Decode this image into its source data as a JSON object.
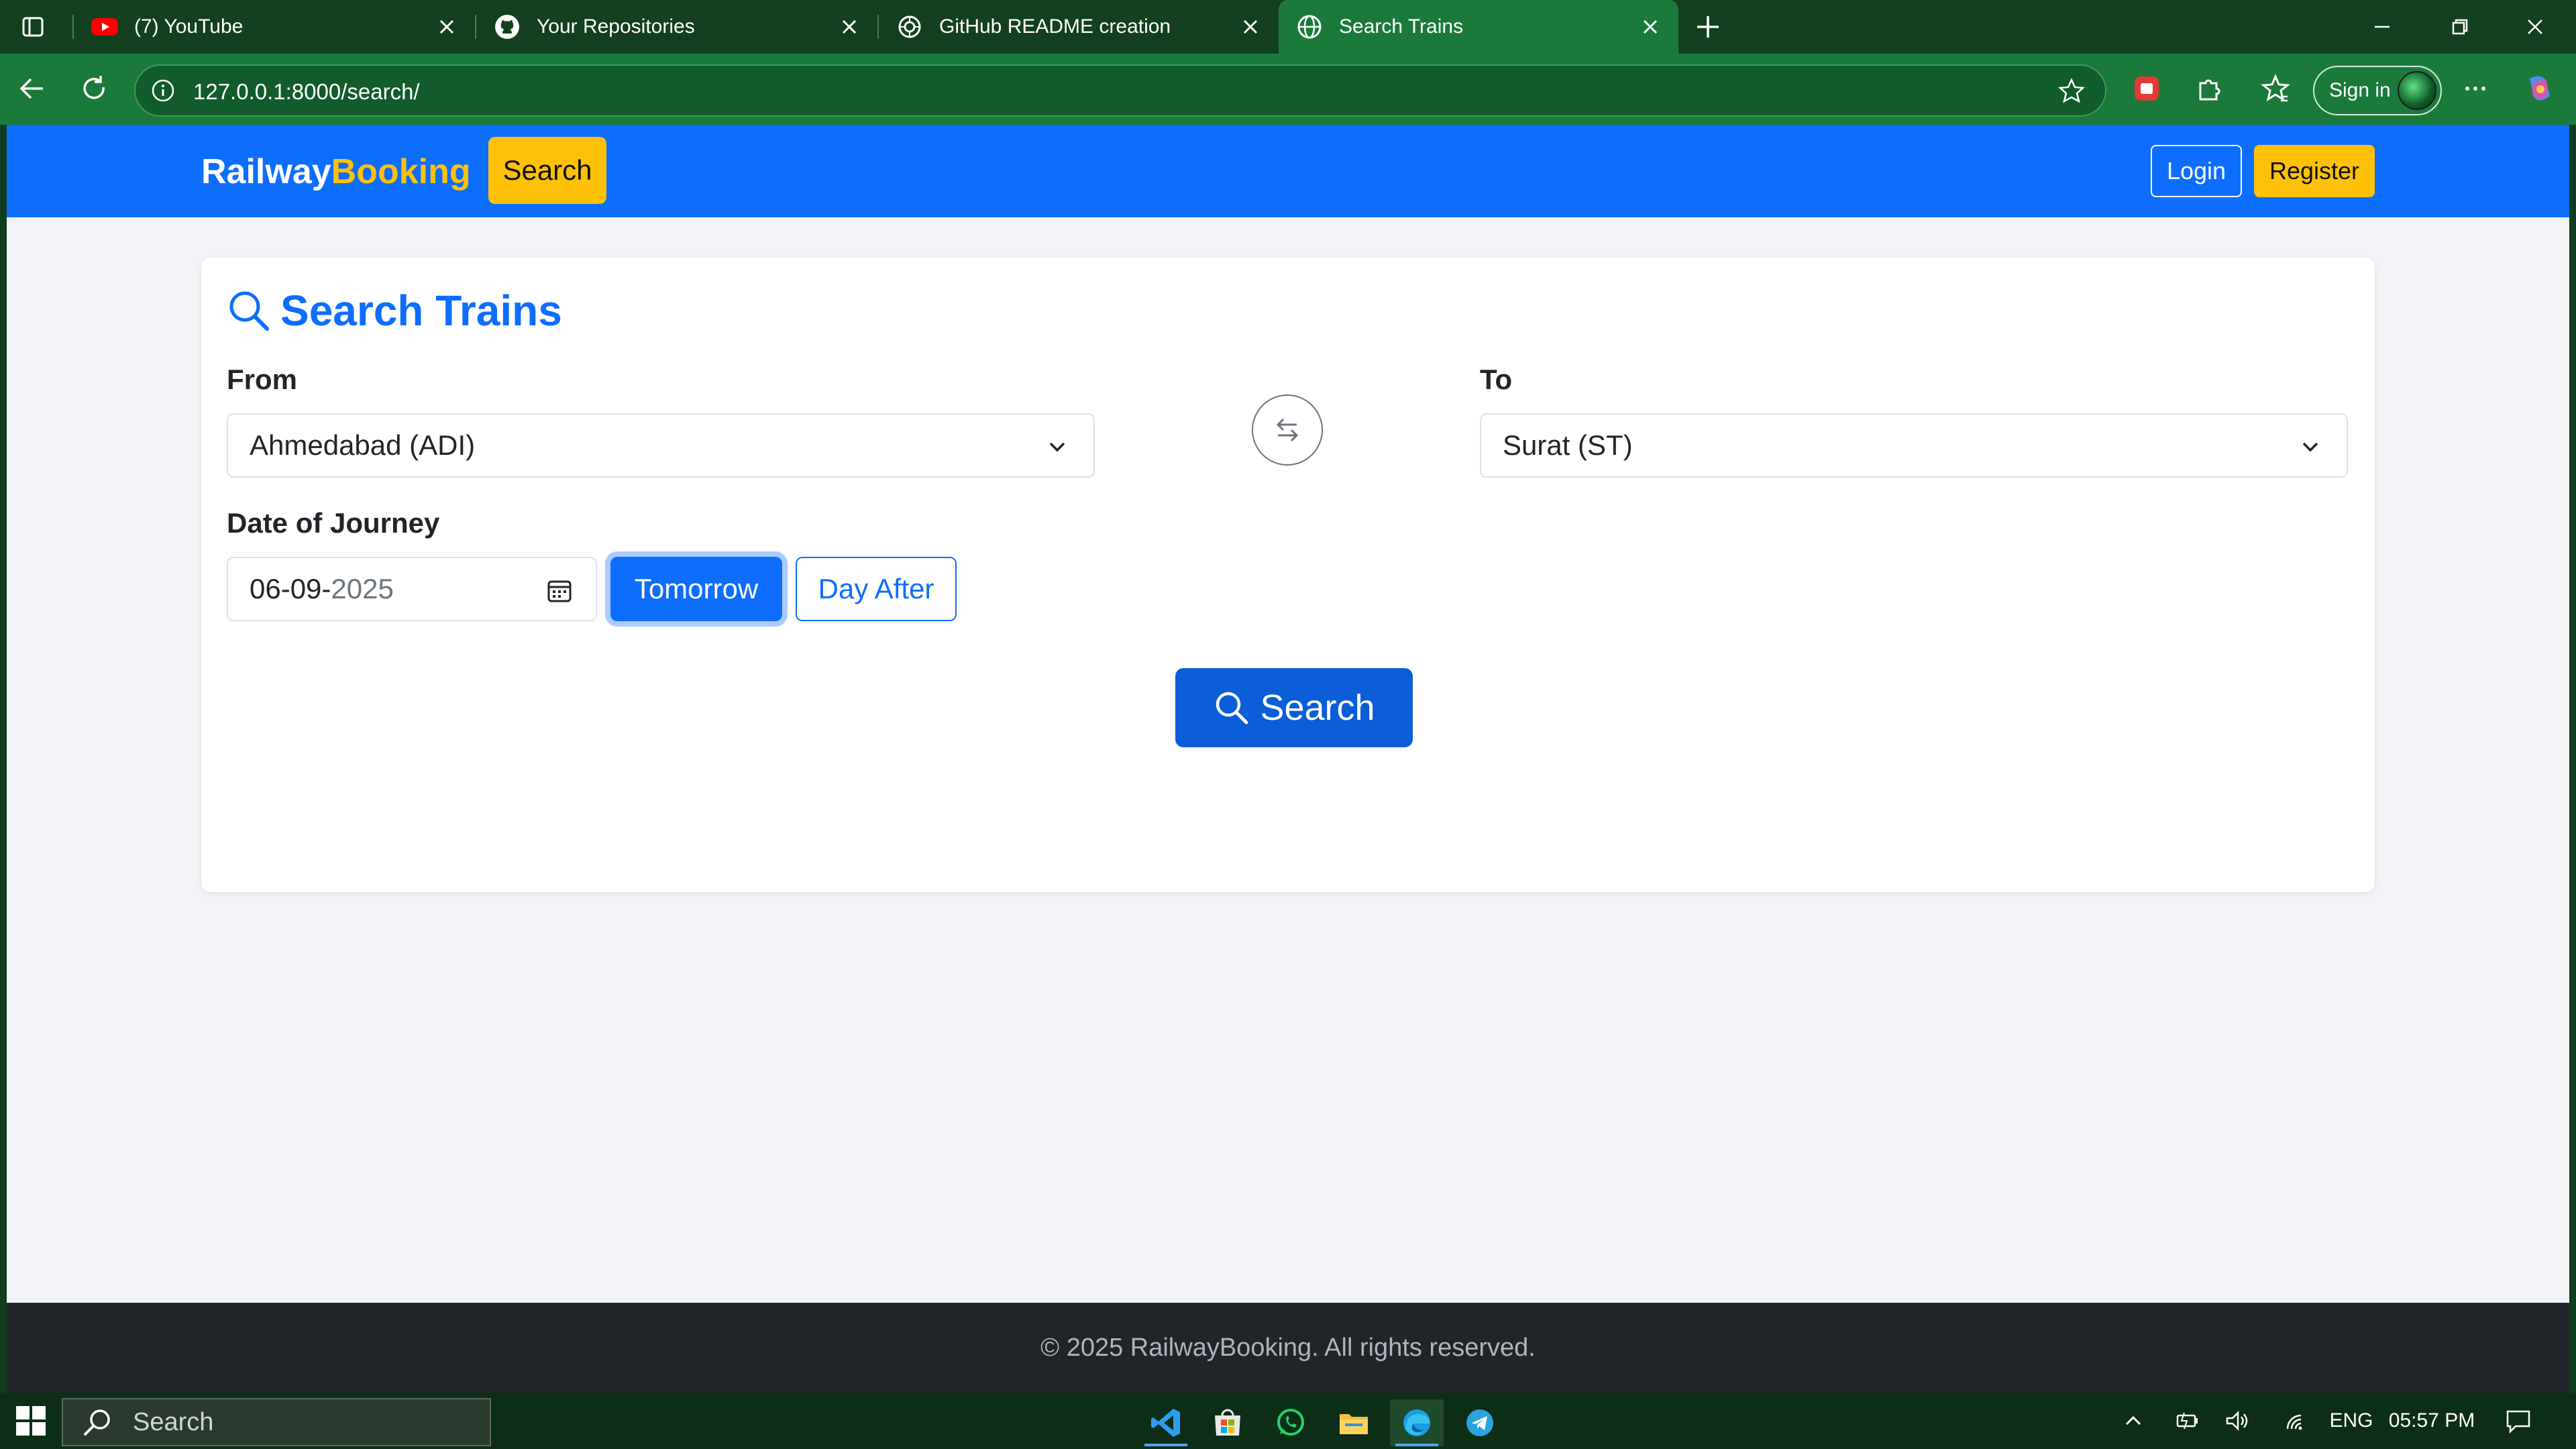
{
  "browser": {
    "tabs": [
      {
        "title": "(7) YouTube",
        "icon": "youtube-icon"
      },
      {
        "title": "Your Repositories",
        "icon": "github-icon"
      },
      {
        "title": "GitHub README creation",
        "icon": "chatgpt-icon"
      },
      {
        "title": "Search Trains",
        "icon": "globe-icon"
      }
    ],
    "url": "127.0.0.1:8000/search/",
    "signin_label": "Sign in"
  },
  "navbar": {
    "brand_part1": "Railway",
    "brand_part2": "Booking",
    "search_label": "Search",
    "login_label": "Login",
    "register_label": "Register"
  },
  "search_form": {
    "title": "Search Trains",
    "from_label": "From",
    "from_value": "Ahmedabad (ADI)",
    "to_label": "To",
    "to_value": "Surat (ST)",
    "date_label": "Date of Journey",
    "date_day_month": "06-09-",
    "date_year": "2025",
    "tomorrow_label": "Tomorrow",
    "day_after_label": "Day After",
    "search_button_label": "Search"
  },
  "footer": {
    "text": "© 2025 RailwayBooking. All rights reserved."
  },
  "taskbar": {
    "search_placeholder": "Search",
    "language": "ENG",
    "time": "05:57 PM"
  },
  "colors": {
    "primary": "#0d6efd",
    "warning": "#ffc107",
    "browser_green": "#1b7a3a",
    "footer_dark": "#212529"
  }
}
